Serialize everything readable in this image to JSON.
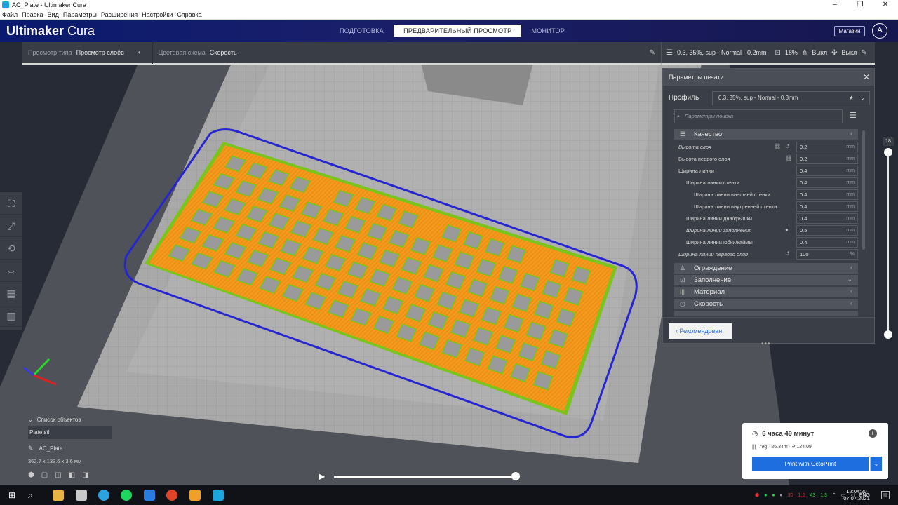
{
  "window": {
    "title": "AC_Plate - Ultimaker Cura",
    "controls": [
      "–",
      "❐",
      "✕"
    ]
  },
  "menu": [
    "Файл",
    "Правка",
    "Вид",
    "Параметры",
    "Расширения",
    "Настройки",
    "Справка"
  ],
  "header": {
    "logo_bold": "Ultimaker",
    "logo_light": " Cura",
    "stages": [
      "ПОДГОТОВКА",
      "ПРЕДВАРИТЕЛЬНЫЙ ПРОСМОТР",
      "МОНИТОР"
    ],
    "active_stage": 1,
    "shop": "Магазин",
    "account": "A"
  },
  "viewbar": {
    "type_label": "Просмотр типа",
    "type_value": "Просмотр слоёв",
    "scheme_label": "Цветовая схема",
    "scheme_value": "Скорость"
  },
  "summary": {
    "profile": "0.3, 35%, sup - Normal - 0.2mm",
    "infill": "18%",
    "support": "Выкл",
    "adhesion": "Выкл"
  },
  "panel": {
    "title": "Параметры печати",
    "profile_label": "Профиль",
    "profile_value": "0.3, 35%, sup - Normal - 0.3mm",
    "search_placeholder": "Параметры поиска",
    "categories": {
      "quality": "Качество",
      "walls": "Ограждение",
      "infill": "Заполнение",
      "material": "Материал",
      "speed": "Скорость"
    },
    "settings": [
      {
        "name": "Высота слоя",
        "value": "0.2",
        "unit": "mm"
      },
      {
        "name": "Высота первого слоя",
        "value": "0.2",
        "unit": "mm"
      },
      {
        "name": "Ширина линии",
        "value": "0.4",
        "unit": "mm"
      },
      {
        "name": "Ширина линии стенки",
        "value": "0.4",
        "unit": "mm"
      },
      {
        "name": "Ширина линии внешней стенки",
        "value": "0.4",
        "unit": "mm"
      },
      {
        "name": "Ширина линии внутренней стенки",
        "value": "0.4",
        "unit": "mm"
      },
      {
        "name": "Ширина линии дна/крышки",
        "value": "0.4",
        "unit": "mm"
      },
      {
        "name": "Ширина линии заполнения",
        "value": "0.5",
        "unit": "mm"
      },
      {
        "name": "Ширина линии юбки/каймы",
        "value": "0.4",
        "unit": "mm"
      },
      {
        "name": "Ширина линии первого слоя",
        "value": "100",
        "unit": "%"
      }
    ],
    "recommended": "Рекомендован"
  },
  "layer_slider": {
    "top_layer": "18"
  },
  "objects": {
    "header": "Список объектов",
    "file": "Plate.stl",
    "name": "AC_Plate",
    "dims": "362.7 x 133.6 x 3.6 мм"
  },
  "estimate": {
    "time": "6 часа 49 минут",
    "material": "79g · 26.34m · ₽ 124.09",
    "print_button": "Print with OctoPrint"
  },
  "taskbar": {
    "tray": [
      "30",
      "1,2",
      "43",
      "1,3"
    ],
    "lang": "ENG",
    "time": "12:04:20",
    "date": "07.07.2021"
  },
  "colors": {
    "header_blue": "#0a1a6e",
    "accent_blue": "#1e6ee0",
    "print_orange": "#f39a1c",
    "print_green": "#7ac41c",
    "skirt_blue": "#2a2ad8"
  }
}
